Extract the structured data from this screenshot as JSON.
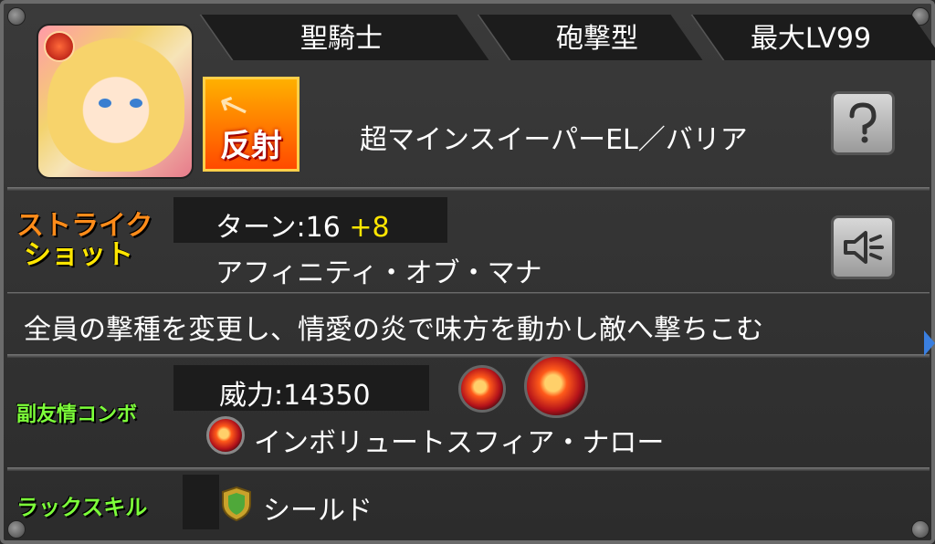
{
  "header": {
    "tab1": "聖騎士",
    "tab2": "砲撃型",
    "tab3": "最大LV99"
  },
  "character": {
    "gimmick_label": "反射",
    "ability": "超マインスイーパーEL／バリア"
  },
  "strike_shot": {
    "section_label_line1": "ストライク",
    "section_label_line2": "ショット",
    "turn_label": "ターン:16",
    "turn_bonus": "+8",
    "name": "アフィニティ・オブ・マナ",
    "description": "全員の撃種を変更し、情愛の炎で味方を動かし敵へ撃ちこむ"
  },
  "sub_combo": {
    "section_label": "副友情コンボ",
    "power": "威力:14350",
    "name": "インボリュートスフィア・ナロー"
  },
  "luck_skill": {
    "section_label": "ラックスキル",
    "name": "シールド"
  },
  "icons": {
    "help": "question-icon",
    "sound": "speaker-icon"
  },
  "colors": {
    "strike_label": "#ff8c1a",
    "combo_label": "#7dff3a",
    "luck_label": "#7dff3a",
    "turn_bonus": "#ffe600"
  }
}
